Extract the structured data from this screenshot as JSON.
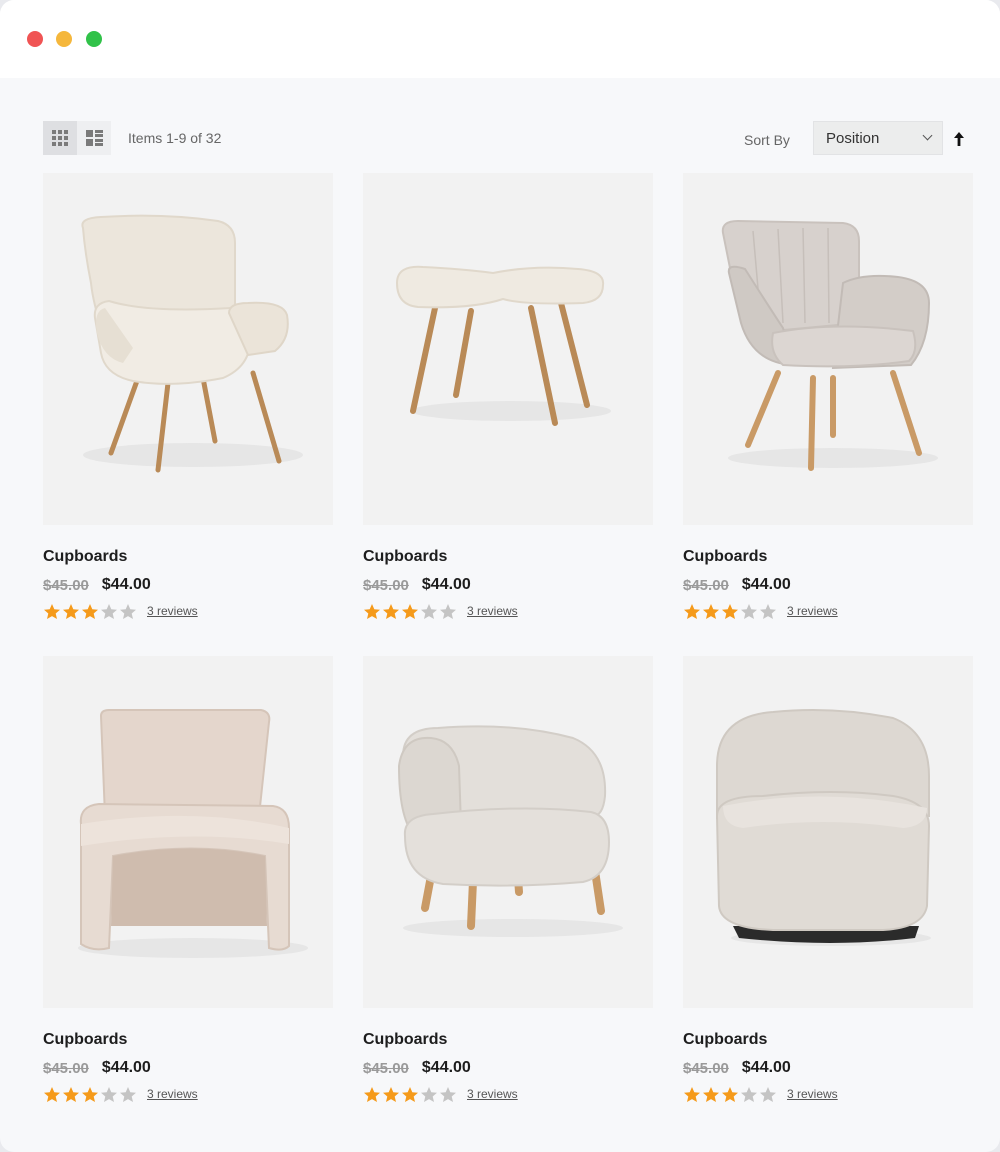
{
  "toolbar": {
    "items_label": "Items 1-9 of 32",
    "sort_label": "Sort By",
    "sort_value": "Position",
    "grid_view_icon": "grid-view-icon",
    "list_view_icon": "list-view-icon",
    "sort_direction_icon": "arrow-up-icon"
  },
  "colors": {
    "star_filled": "#f59a1a",
    "star_empty": "#c4c4c4",
    "card_bg": "#f2f2f2",
    "page_bg": "#f7f8fa"
  },
  "products": [
    {
      "name": "Cupboards",
      "old_price": "$45.00",
      "price": "$44.00",
      "rating": 3,
      "max_rating": 5,
      "reviews": "3 reviews",
      "image": "wingback-chair"
    },
    {
      "name": "Cupboards",
      "old_price": "$45.00",
      "price": "$44.00",
      "rating": 3,
      "max_rating": 5,
      "reviews": "3 reviews",
      "image": "footstool"
    },
    {
      "name": "Cupboards",
      "old_price": "$45.00",
      "price": "$44.00",
      "rating": 3,
      "max_rating": 5,
      "reviews": "3 reviews",
      "image": "armchair"
    },
    {
      "name": "Cupboards",
      "old_price": "$45.00",
      "price": "$44.00",
      "rating": 3,
      "max_rating": 5,
      "reviews": "3 reviews",
      "image": "slipper-chair"
    },
    {
      "name": "Cupboards",
      "old_price": "$45.00",
      "price": "$44.00",
      "rating": 3,
      "max_rating": 5,
      "reviews": "3 reviews",
      "image": "barrel-chair"
    },
    {
      "name": "Cupboards",
      "old_price": "$45.00",
      "price": "$44.00",
      "rating": 3,
      "max_rating": 5,
      "reviews": "3 reviews",
      "image": "swivel-chair"
    }
  ]
}
